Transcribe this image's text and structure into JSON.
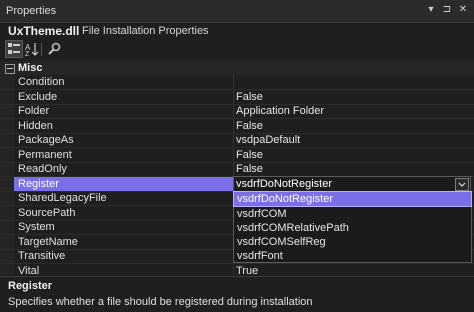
{
  "window": {
    "title": "Properties",
    "controls": [
      "▾",
      "⊐",
      "✕"
    ]
  },
  "header": {
    "object_name": "UxTheme.dll",
    "object_type": "File Installation Properties"
  },
  "toolbar": {
    "buttons": [
      "categorized-icon",
      "alphabetical-icon",
      "property-pages-icon"
    ]
  },
  "grid": {
    "category": "Misc",
    "rows": [
      {
        "name": "Condition",
        "value": ""
      },
      {
        "name": "Exclude",
        "value": "False"
      },
      {
        "name": "Folder",
        "value": "Application Folder"
      },
      {
        "name": "Hidden",
        "value": "False"
      },
      {
        "name": "PackageAs",
        "value": "vsdpaDefault"
      },
      {
        "name": "Permanent",
        "value": "False"
      },
      {
        "name": "ReadOnly",
        "value": "False"
      },
      {
        "name": "Register",
        "value": "vsdrfDoNotRegister"
      },
      {
        "name": "SharedLegacyFile",
        "value": ""
      },
      {
        "name": "SourcePath",
        "value": ""
      },
      {
        "name": "System",
        "value": ""
      },
      {
        "name": "TargetName",
        "value": ""
      },
      {
        "name": "Transitive",
        "value": ""
      },
      {
        "name": "Vital",
        "value": "True"
      }
    ],
    "selected_property": "Register",
    "editor_value": "vsdrfDoNotRegister",
    "dropdown_options": [
      "vsdrfDoNotRegister",
      "vsdrfCOM",
      "vsdrfCOMRelativePath",
      "vsdrfCOMSelfReg",
      "vsdrfFont"
    ],
    "highlighted_option": "vsdrfDoNotRegister"
  },
  "description": {
    "title": "Register",
    "text": "Specifies whether a file should be registered during installation"
  }
}
